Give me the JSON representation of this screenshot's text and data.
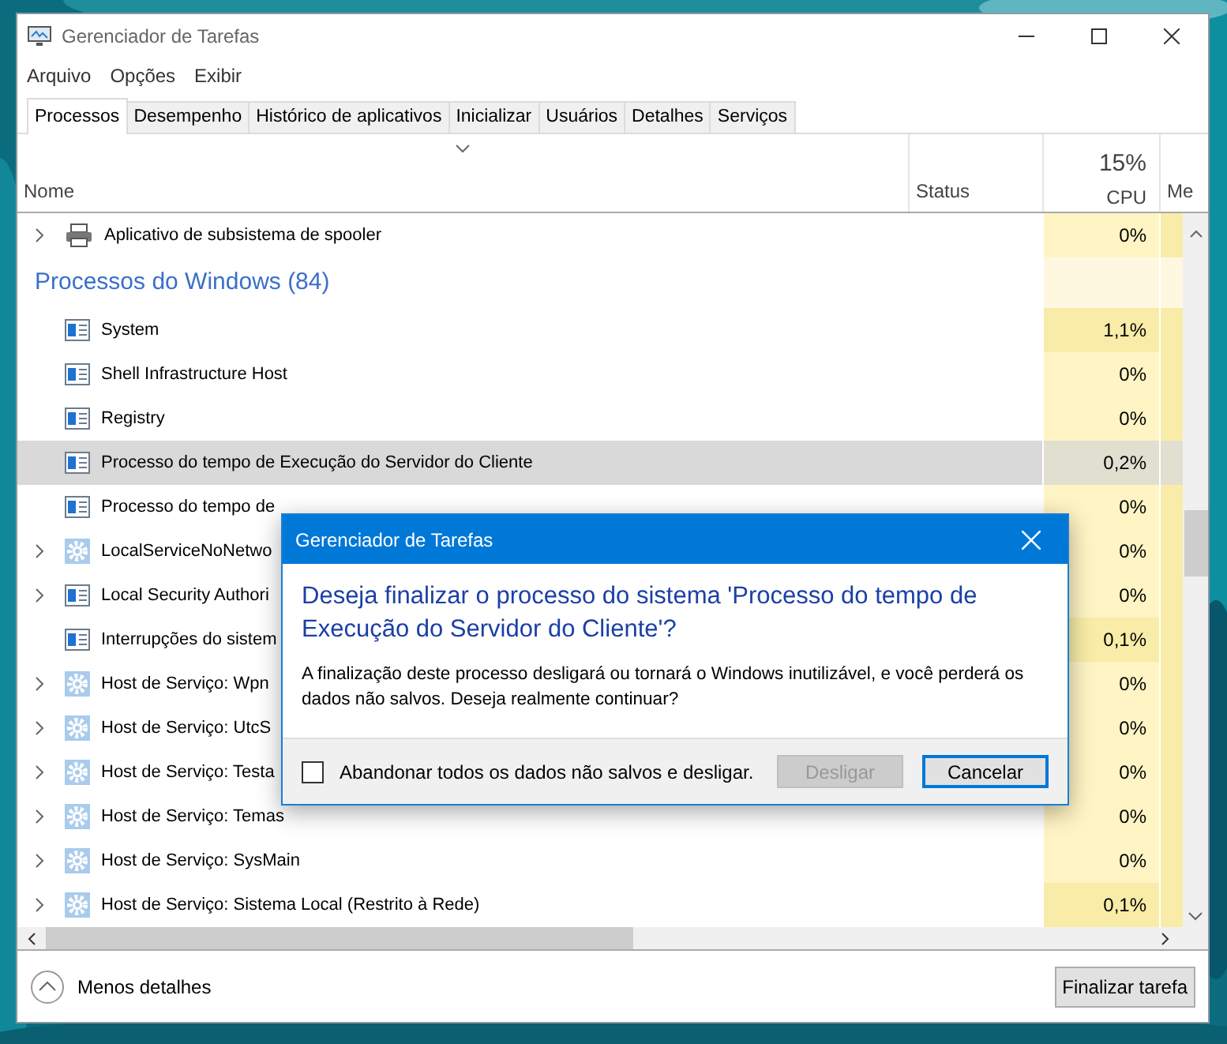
{
  "window": {
    "title": "Gerenciador de Tarefas"
  },
  "menu": [
    "Arquivo",
    "Opções",
    "Exibir"
  ],
  "tabs": [
    {
      "label": "Processos",
      "selected": true
    },
    {
      "label": "Desempenho",
      "selected": false
    },
    {
      "label": "Histórico de aplicativos",
      "selected": false
    },
    {
      "label": "Inicializar",
      "selected": false
    },
    {
      "label": "Usuários",
      "selected": false
    },
    {
      "label": "Detalhes",
      "selected": false
    },
    {
      "label": "Serviços",
      "selected": false
    }
  ],
  "table": {
    "cpu_total": "15%",
    "columns": [
      "Nome",
      "Status",
      "CPU",
      "Me"
    ],
    "rows": [
      {
        "kind": "printer",
        "expandable": true,
        "name": "Aplicativo de subsistema de spooler",
        "cpu": "0%",
        "cpu_hot": false,
        "selected": false
      },
      {
        "kind": "group",
        "name": "Processos do Windows (84)"
      },
      {
        "kind": "system",
        "expandable": false,
        "name": "System",
        "cpu": "1,1%",
        "cpu_hot": true,
        "selected": false
      },
      {
        "kind": "system",
        "expandable": false,
        "name": "Shell Infrastructure Host",
        "cpu": "0%",
        "cpu_hot": false,
        "selected": false
      },
      {
        "kind": "system",
        "expandable": false,
        "name": "Registry",
        "cpu": "0%",
        "cpu_hot": false,
        "selected": false
      },
      {
        "kind": "system",
        "expandable": false,
        "name": "Processo do tempo de Execução do Servidor do Cliente",
        "cpu": "0,2%",
        "cpu_hot": false,
        "selected": true
      },
      {
        "kind": "system",
        "expandable": false,
        "name": "Processo do tempo de",
        "cpu": "0%",
        "cpu_hot": false,
        "selected": false
      },
      {
        "kind": "service",
        "expandable": true,
        "name": "LocalServiceNoNetwo",
        "cpu": "0%",
        "cpu_hot": false,
        "selected": false
      },
      {
        "kind": "system",
        "expandable": true,
        "name": "Local Security Authori",
        "cpu": "0%",
        "cpu_hot": false,
        "selected": false
      },
      {
        "kind": "system",
        "expandable": false,
        "name": "Interrupções do sistem",
        "cpu": "0,1%",
        "cpu_hot": true,
        "selected": false
      },
      {
        "kind": "service",
        "expandable": true,
        "name": "Host de Serviço: Wpn",
        "cpu": "0%",
        "cpu_hot": false,
        "selected": false
      },
      {
        "kind": "service",
        "expandable": true,
        "name": "Host de Serviço: UtcS",
        "cpu": "0%",
        "cpu_hot": false,
        "selected": false
      },
      {
        "kind": "service",
        "expandable": true,
        "name": "Host de Serviço: Testa",
        "cpu": "0%",
        "cpu_hot": false,
        "selected": false
      },
      {
        "kind": "service",
        "expandable": true,
        "name": "Host de Serviço: Temas",
        "cpu": "0%",
        "cpu_hot": false,
        "selected": false
      },
      {
        "kind": "service",
        "expandable": true,
        "name": "Host de Serviço: SysMain",
        "cpu": "0%",
        "cpu_hot": false,
        "selected": false
      },
      {
        "kind": "service",
        "expandable": true,
        "name": "Host de Serviço: Sistema Local (Restrito à Rede)",
        "cpu": "0,1%",
        "cpu_hot": true,
        "selected": false
      }
    ]
  },
  "footer": {
    "details_toggle": "Menos detalhes",
    "end_task": "Finalizar tarefa"
  },
  "dialog": {
    "title": "Gerenciador de Tarefas",
    "heading": "Deseja finalizar o processo do sistema 'Processo do tempo de Execução do Servidor do Cliente'?",
    "message": "A finalização deste processo desligará ou tornará o Windows inutilizável, e você perderá os dados não salvos. Deseja realmente continuar?",
    "checkbox": {
      "label": "Abandonar todos os dados não salvos e desligar.",
      "checked": false
    },
    "buttons": [
      {
        "label": "Desligar",
        "disabled": true
      },
      {
        "label": "Cancelar",
        "disabled": false
      }
    ]
  }
}
